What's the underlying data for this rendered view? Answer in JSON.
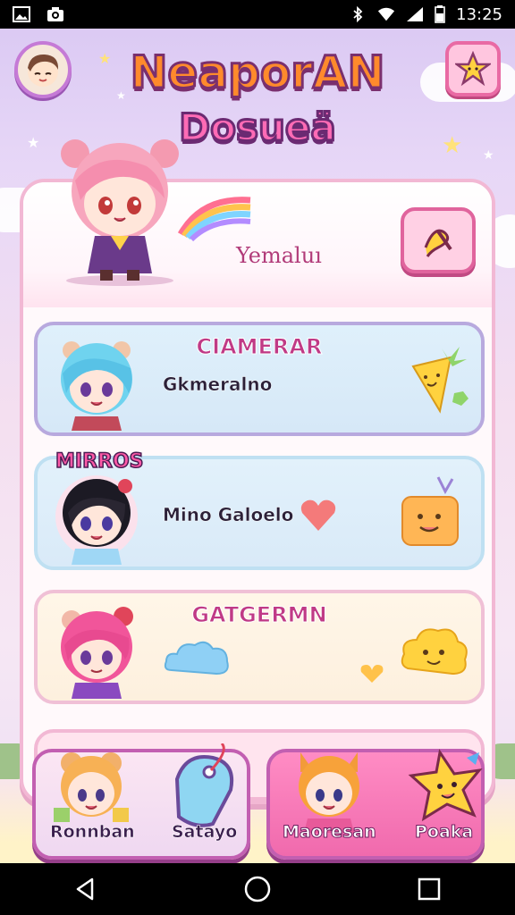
{
  "status_bar": {
    "time": "13:25",
    "icons": [
      "gallery-icon",
      "camera-icon",
      "bluetooth-icon",
      "wifi-icon",
      "signal-icon",
      "battery-icon"
    ]
  },
  "header": {
    "logo_line1": "NeaporAN",
    "logo_line2": "Dosueä",
    "avatar_icon": "avatar-face-icon",
    "star_icon": "star-icon"
  },
  "profile": {
    "name": "Yemaluı",
    "edit_icon": "edit-icon"
  },
  "cards": [
    {
      "title": "CIAMERAR",
      "label": "Gkmeralno",
      "deco": "carrot-icon"
    },
    {
      "tag": "MIRROS",
      "label": "Mino Galoelo",
      "deco": "block-face-icon"
    },
    {
      "title": "GATGERMN",
      "label": "",
      "deco": "cloud-face-icon"
    }
  ],
  "bottom_buttons": {
    "left": {
      "a": "Ronnban",
      "b": "Satayo"
    },
    "right": {
      "a": "Maoresan",
      "b": "Poaka"
    }
  },
  "nav": [
    "back-icon",
    "home-icon",
    "recents-icon"
  ],
  "colors": {
    "accent_pink": "#e96aa4",
    "accent_purple": "#c25fb1",
    "logo_orange": "#ff8a2c",
    "title_magenta": "#c03a86"
  }
}
